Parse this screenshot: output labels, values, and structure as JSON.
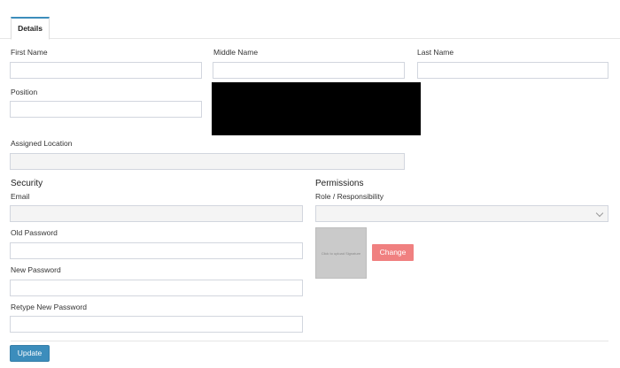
{
  "tabs": [
    {
      "label": "Details"
    }
  ],
  "fields": {
    "first_name": {
      "label": "First Name",
      "value": ""
    },
    "middle_name": {
      "label": "Middle Name",
      "value": ""
    },
    "last_name": {
      "label": "Last Name",
      "value": ""
    },
    "position": {
      "label": "Position",
      "value": ""
    },
    "assigned_location": {
      "label": "Assigned Location",
      "value": ""
    }
  },
  "security": {
    "title": "Security",
    "email": {
      "label": "Email",
      "value": ""
    },
    "old_password": {
      "label": "Old Password",
      "value": ""
    },
    "new_password": {
      "label": "New Password",
      "value": ""
    },
    "retype_password": {
      "label": "Retype New Password",
      "value": ""
    }
  },
  "permissions": {
    "title": "Permissions",
    "role": {
      "label": "Role / Responsibility",
      "selected": ""
    }
  },
  "photo": {
    "placeholder_text": "Click to upload Signature"
  },
  "buttons": {
    "change": "Change",
    "update": "Update"
  },
  "colors": {
    "accent": "#3c8dbc",
    "change_button": "#f08080",
    "disabled_field": "#f4f4f4"
  },
  "icons": {
    "select_arrow": "chevron-down-icon"
  }
}
